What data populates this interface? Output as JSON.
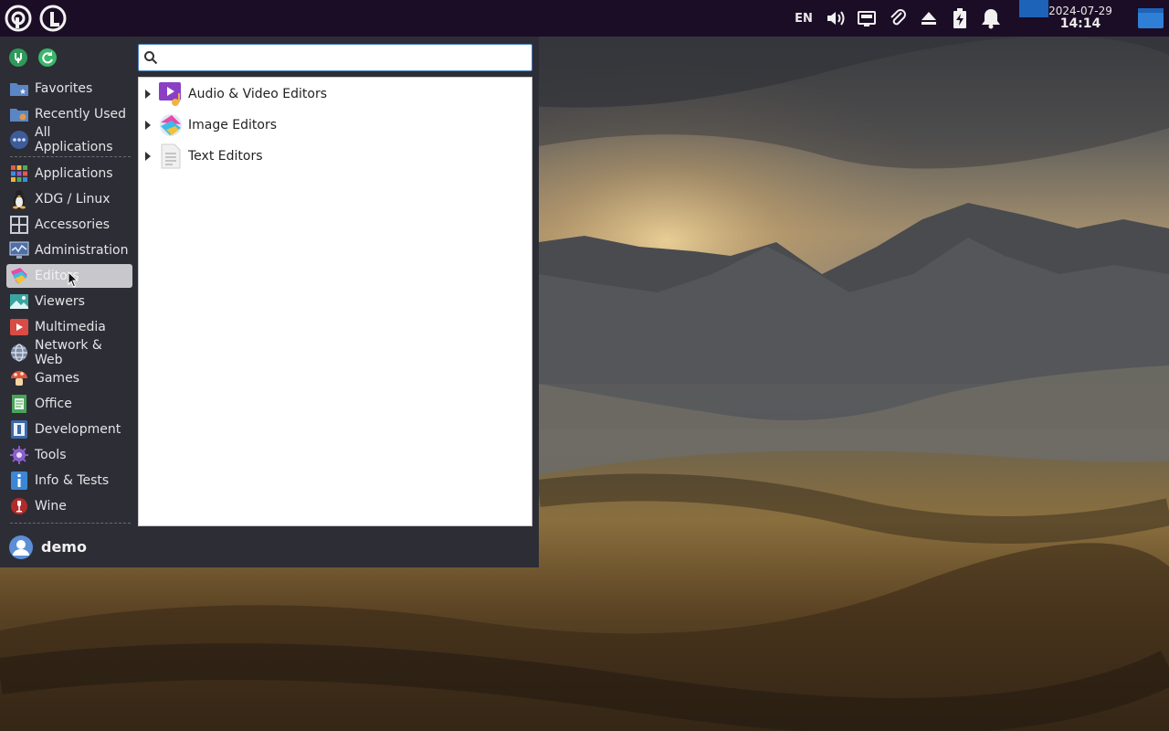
{
  "top_panel": {
    "launcher_icons": [
      "app-menu-logo-icon",
      "app-menu-logo-icon"
    ],
    "language": "EN",
    "tray_icons": [
      "volume-icon",
      "network-icon",
      "clipboard-icon",
      "eject-icon",
      "battery-charging-icon",
      "notification-bell-icon"
    ],
    "clock": {
      "date": "2024-07-29",
      "time": "14:14"
    },
    "show_desktop_icon": "show-desktop-icon"
  },
  "menu": {
    "top_icons": [
      "settings-manager-icon",
      "refresh-icon"
    ],
    "search": {
      "placeholder": "",
      "value": ""
    },
    "categories": [
      {
        "label": "Favorites",
        "icon": "folder-star-icon"
      },
      {
        "label": "Recently Used",
        "icon": "folder-clock-icon"
      },
      {
        "label": "All Applications",
        "icon": "all-apps-dots-icon"
      },
      {
        "label": "Applications",
        "icon": "grid-icon"
      },
      {
        "label": "XDG / Linux",
        "icon": "tux-icon"
      },
      {
        "label": "Accessories",
        "icon": "accessories-icon"
      },
      {
        "label": "Administration",
        "icon": "system-monitor-icon"
      },
      {
        "label": "Editors",
        "icon": "editors-icon",
        "selected": true
      },
      {
        "label": "Viewers",
        "icon": "image-viewer-icon"
      },
      {
        "label": "Multimedia",
        "icon": "video-icon"
      },
      {
        "label": "Network & Web",
        "icon": "globe-icon"
      },
      {
        "label": "Games",
        "icon": "mushroom-icon"
      },
      {
        "label": "Office",
        "icon": "document-icon"
      },
      {
        "label": "Development",
        "icon": "development-icon"
      },
      {
        "label": "Tools",
        "icon": "tools-icon"
      },
      {
        "label": "Info & Tests",
        "icon": "info-icon"
      },
      {
        "label": "Wine",
        "icon": "wine-icon"
      }
    ],
    "applications": [
      {
        "label": "Audio & Video Editors",
        "icon": "audio-video-editor-icon"
      },
      {
        "label": "Image Editors",
        "icon": "image-editor-icon"
      },
      {
        "label": "Text Editors",
        "icon": "text-editor-icon"
      }
    ],
    "user": {
      "name": "demo",
      "icon": "user-avatar-icon"
    }
  },
  "colors": {
    "panel_bg": "#1c0d26",
    "menu_bg": "#2d2d36",
    "accent": "#1d63b8",
    "selected_bg": "#c8c8cc"
  }
}
